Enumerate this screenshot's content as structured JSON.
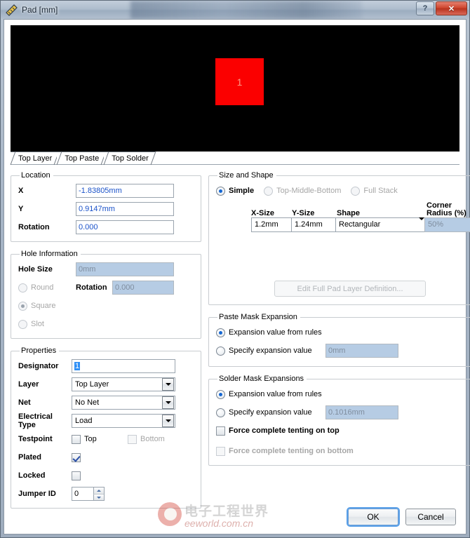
{
  "window": {
    "title": "Pad [mm]",
    "app_icon": "ruler-icon",
    "help_label": "?",
    "close_label": "✕"
  },
  "preview": {
    "pad_designator": "1",
    "pad_color": "#fb0000",
    "background_color": "#000000",
    "designator_color": "#ff9a86"
  },
  "tabs": [
    {
      "label": "Top Layer",
      "active": true
    },
    {
      "label": "Top Paste",
      "active": false
    },
    {
      "label": "Top Solder",
      "active": false
    }
  ],
  "location": {
    "legend": "Location",
    "x_label": "X",
    "x_value": "-1.83805mm",
    "y_label": "Y",
    "y_value": "0.9147mm",
    "rotation_label": "Rotation",
    "rotation_value": "0.000"
  },
  "hole_information": {
    "legend": "Hole Information",
    "hole_size_label": "Hole Size",
    "hole_size_value": "0mm",
    "rotation_label": "Rotation",
    "rotation_value": "0.000",
    "shapes": [
      {
        "label": "Round",
        "checked": false
      },
      {
        "label": "Square",
        "checked": true
      },
      {
        "label": "Slot",
        "checked": false
      }
    ]
  },
  "properties": {
    "legend": "Properties",
    "designator_label": "Designator",
    "designator_value": "1",
    "layer_label": "Layer",
    "layer_value": "Top Layer",
    "net_label": "Net",
    "net_value": "No Net",
    "electrical_type_label": "Electrical Type",
    "electrical_type_value": "Load",
    "testpoint_label": "Testpoint",
    "testpoint_top_label": "Top",
    "testpoint_bottom_label": "Bottom",
    "plated_label": "Plated",
    "locked_label": "Locked",
    "jumper_id_label": "Jumper ID",
    "jumper_id_value": "0"
  },
  "size_and_shape": {
    "legend": "Size and Shape",
    "modes": [
      {
        "label": "Simple",
        "checked": true,
        "disabled": false
      },
      {
        "label": "Top-Middle-Bottom",
        "checked": false,
        "disabled": true
      },
      {
        "label": "Full Stack",
        "checked": false,
        "disabled": true
      }
    ],
    "columns": [
      "X-Size",
      "Y-Size",
      "Shape",
      "Corner Radius (%)"
    ],
    "corner_radius_line1": "Corner",
    "corner_radius_line2": "Radius (%)",
    "x_size": "1.2mm",
    "y_size": "1.24mm",
    "shape": "Rectangular",
    "corner_radius": "50%",
    "edit_button_label": "Edit Full Pad Layer Definition..."
  },
  "paste_mask": {
    "legend": "Paste Mask Expansion",
    "from_rules_label": "Expansion value from rules",
    "from_rules_checked": true,
    "specify_label": "Specify expansion value",
    "specify_checked": false,
    "specify_value": "0mm"
  },
  "solder_mask": {
    "legend": "Solder Mask Expansions",
    "from_rules_label": "Expansion value from rules",
    "from_rules_checked": true,
    "specify_label": "Specify expansion value",
    "specify_checked": false,
    "specify_value": "0.1016mm",
    "force_top_label": "Force complete tenting on top",
    "force_top_checked": false,
    "force_bottom_label": "Force complete tenting on bottom",
    "force_bottom_checked": false
  },
  "footer": {
    "ok_label": "OK",
    "cancel_label": "Cancel"
  },
  "watermark": {
    "cn_text": "电子工程世界",
    "url_text": "eeworld.com.cn"
  }
}
